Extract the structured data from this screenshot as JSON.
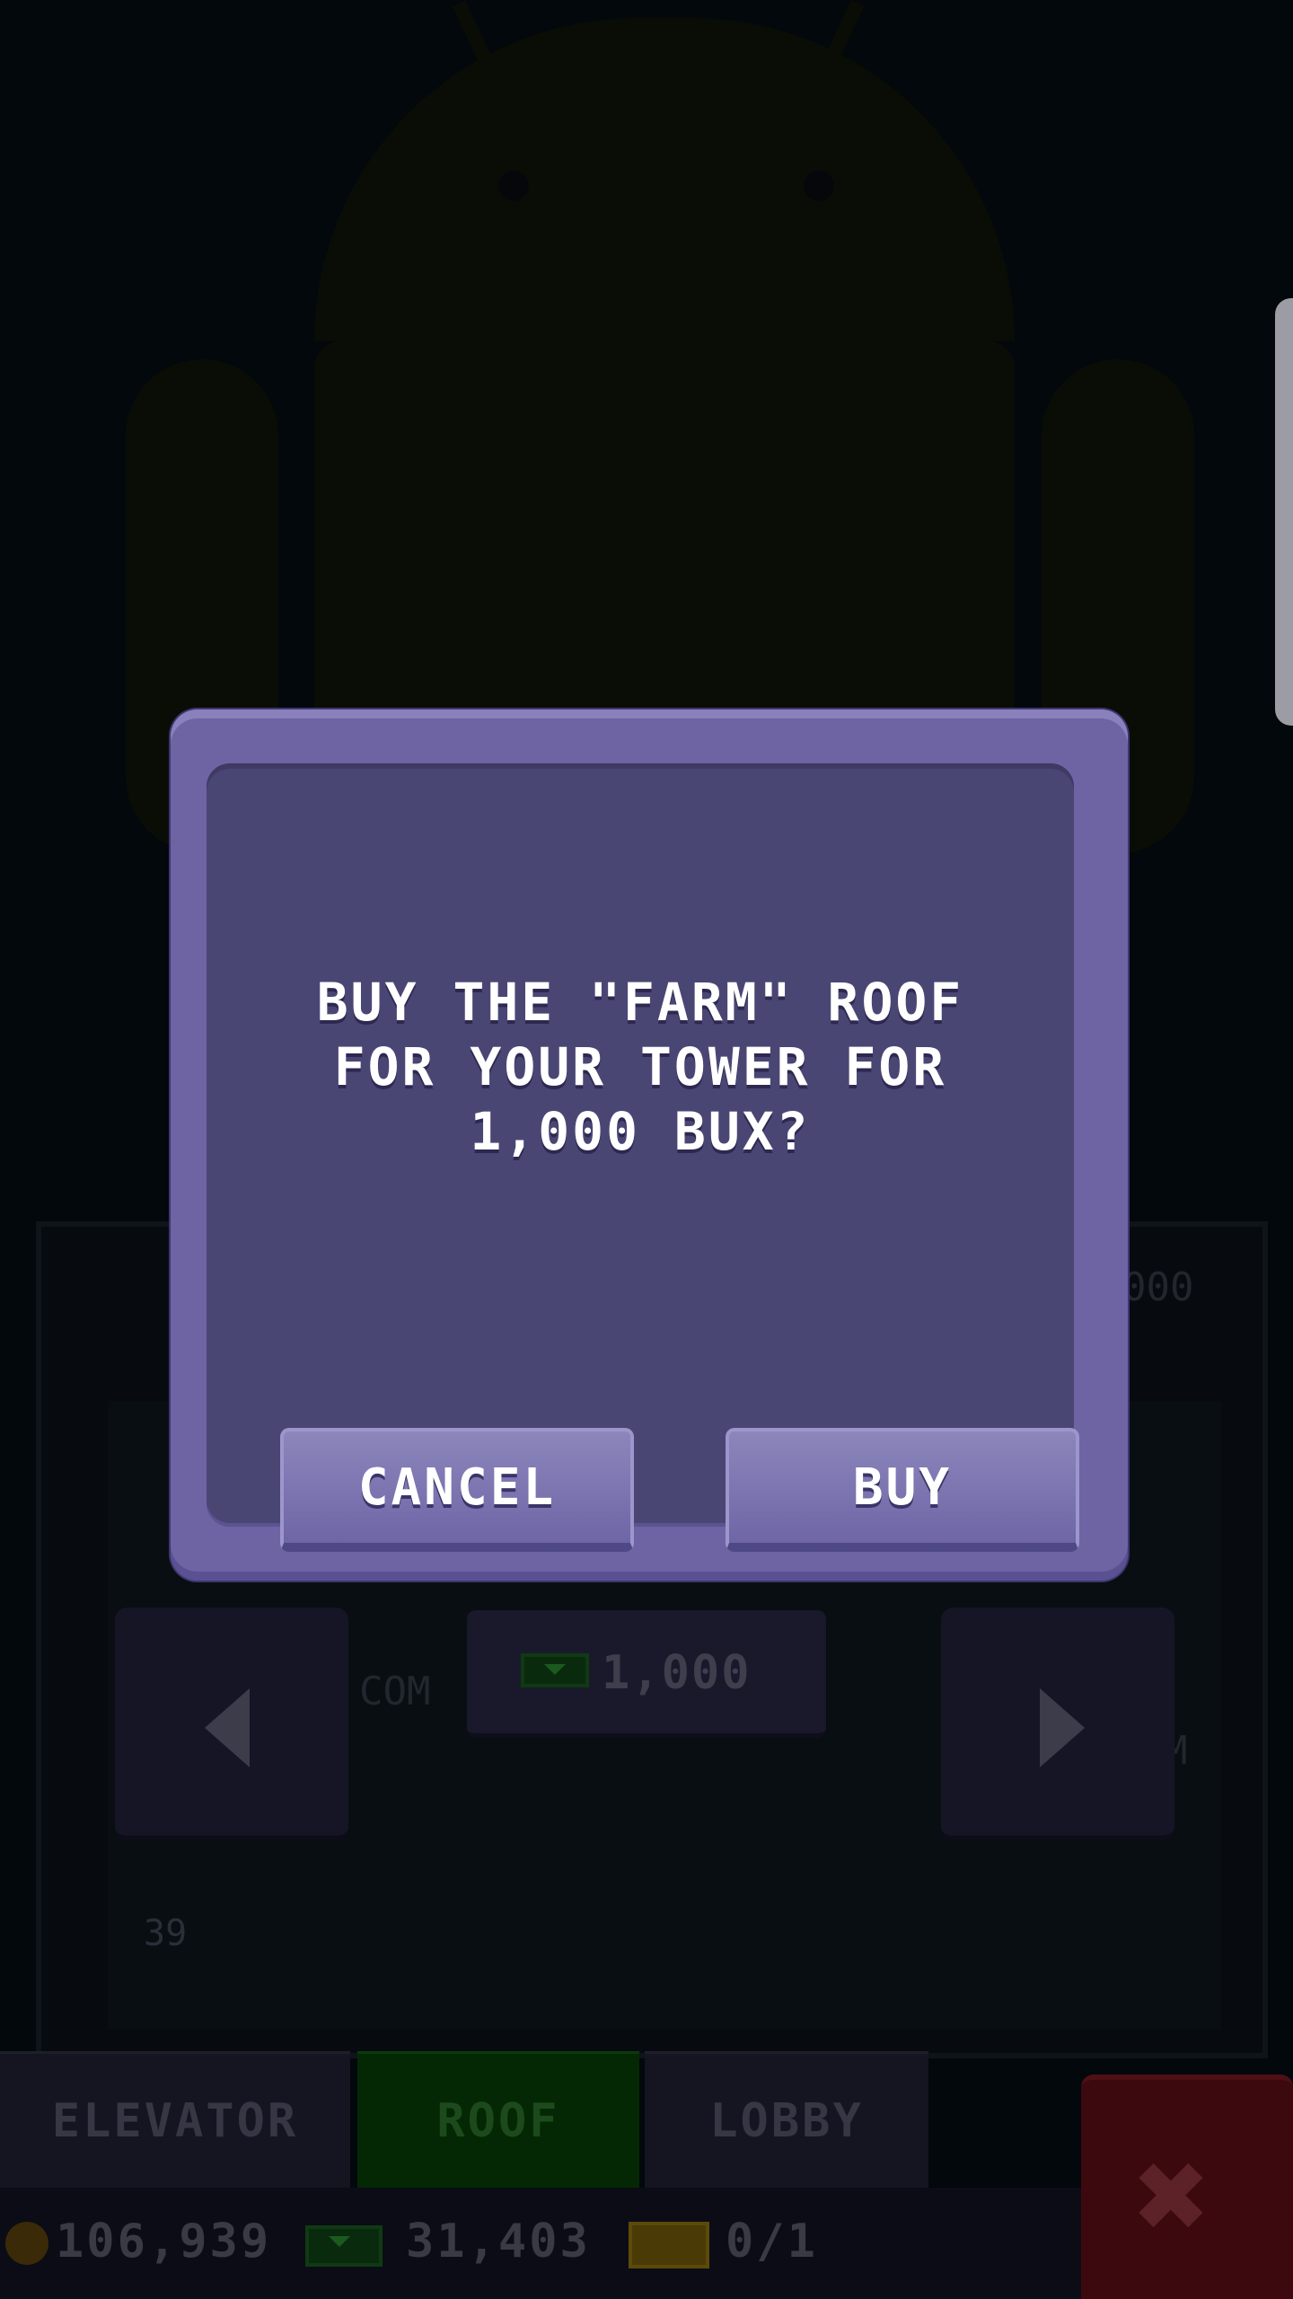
{
  "dialog": {
    "message": "BUY THE \"FARM\" ROOF FOR YOUR TOWER FOR 1,000 BUX?",
    "cancel_label": "CANCEL",
    "buy_label": "BUY"
  },
  "scene": {
    "price": "1,000",
    "floor_number": "39",
    "partial_text_left": "COM",
    "partial_text_right": "M",
    "partial_number": "000"
  },
  "tabs": {
    "elevator": "ELEVATOR",
    "roof": "ROOF",
    "lobby": "LOBBY"
  },
  "status": {
    "coins": "106,939",
    "bux": "31,403",
    "tickets": "0/1"
  },
  "icons": {
    "prev": "arrow-left-icon",
    "next": "arrow-right-icon",
    "close": "close-x-icon",
    "coin": "coin-icon",
    "bux": "bux-icon",
    "ticket": "ticket-icon"
  },
  "colors": {
    "dialog_frame": "#6e64a4",
    "dialog_inner": "#4a4674",
    "button": "#7c76b2",
    "roof_tab_active": "#042804",
    "close_button": "#3c0a0e"
  }
}
